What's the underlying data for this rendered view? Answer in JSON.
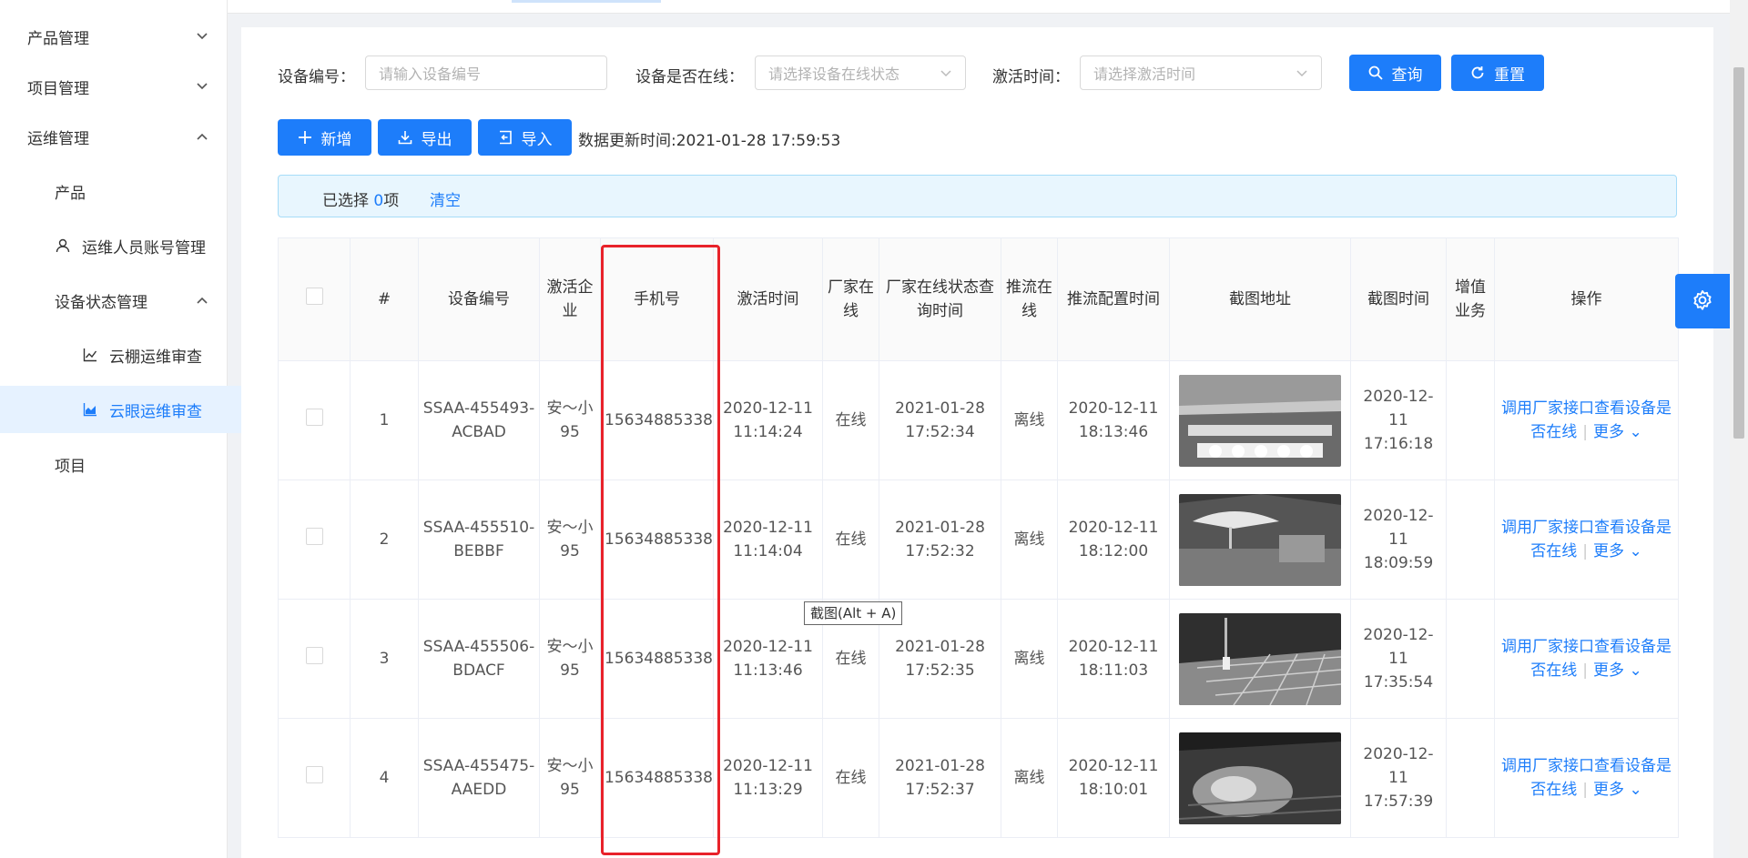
{
  "sidebar": {
    "items": [
      {
        "label": "产品管理",
        "chev": "⌄"
      },
      {
        "label": "项目管理",
        "chev": "⌄"
      },
      {
        "label": "运维管理",
        "chev": "⌃"
      },
      {
        "label": "产品"
      },
      {
        "label": "运维人员账号管理"
      },
      {
        "label": "设备状态管理",
        "chev": "⌃"
      },
      {
        "label": "云棚运维审查"
      },
      {
        "label": "云眼运维审查"
      },
      {
        "label": "项目"
      }
    ]
  },
  "filters": {
    "device_no_label": "设备编号：",
    "device_no_placeholder": "请输入设备编号",
    "online_label": "设备是否在线：",
    "online_placeholder": "请选择设备在线状态",
    "activate_label": "激活时间：",
    "activate_placeholder": "请选择激活时间",
    "search_label": "查询",
    "reset_label": "重置"
  },
  "toolbar": {
    "add_label": "新增",
    "export_label": "导出",
    "import_label": "导入",
    "update_time": "数据更新时间:2021-01-28 17:59:53"
  },
  "selection": {
    "prefix": "已选择 ",
    "count": "0",
    "suffix": "项",
    "clear_label": "清空"
  },
  "table": {
    "headers": {
      "index": "#",
      "device_no": "设备编号",
      "company": "激活企业",
      "phone": "手机号",
      "activate_time": "激活时间",
      "vendor_online": "厂家在线",
      "vendor_query_time": "厂家在线状态查询时间",
      "stream_online": "推流在线",
      "stream_config_time": "推流配置时间",
      "screenshot_url": "截图地址",
      "screenshot_time": "截图时间",
      "value_added": "增值业务",
      "ops": "操作"
    },
    "rows": [
      {
        "index": "1",
        "device_no": "SSAA-455493-ACBAD",
        "company": "安～小95",
        "phone": "15634885338",
        "activate_time": "2020-12-11 11:14:24",
        "vendor_online": "在线",
        "vendor_query_time": "2021-01-28 17:52:34",
        "stream_online": "离线",
        "stream_config_time": "2020-12-11 18:13:46",
        "screenshot_time": "2020-12-11 17:16:18",
        "op_check": "调用厂家接口查看设备是否在线",
        "op_more": "更多"
      },
      {
        "index": "2",
        "device_no": "SSAA-455510-BEBBF",
        "company": "安～小95",
        "phone": "15634885338",
        "activate_time": "2020-12-11 11:14:04",
        "vendor_online": "在线",
        "vendor_query_time": "2021-01-28 17:52:32",
        "stream_online": "离线",
        "stream_config_time": "2020-12-11 18:12:00",
        "screenshot_time": "2020-12-11 18:09:59",
        "op_check": "调用厂家接口查看设备是否在线",
        "op_more": "更多"
      },
      {
        "index": "3",
        "device_no": "SSAA-455506-BDACF",
        "company": "安～小95",
        "phone": "15634885338",
        "activate_time": "2020-12-11 11:13:46",
        "vendor_online": "在线",
        "vendor_query_time": "2021-01-28 17:52:35",
        "stream_online": "离线",
        "stream_config_time": "2020-12-11 18:11:03",
        "screenshot_time": "2020-12-11 17:35:54",
        "op_check": "调用厂家接口查看设备是否在线",
        "op_more": "更多"
      },
      {
        "index": "4",
        "device_no": "SSAA-455475-AAEDD",
        "company": "安～小95",
        "phone": "15634885338",
        "activate_time": "2020-12-11 11:13:29",
        "vendor_online": "在线",
        "vendor_query_time": "2021-01-28 17:52:37",
        "stream_online": "离线",
        "stream_config_time": "2020-12-11 18:10:01",
        "screenshot_time": "2020-12-11 17:57:39",
        "op_check": "调用厂家接口查看设备是否在线",
        "op_more": "更多"
      }
    ]
  },
  "tooltip": "截图(Alt + A)",
  "colors": {
    "primary": "#1d7dfa",
    "online": "#3ad13a",
    "offline": "#f0282d",
    "highlight": "#e8222a"
  }
}
